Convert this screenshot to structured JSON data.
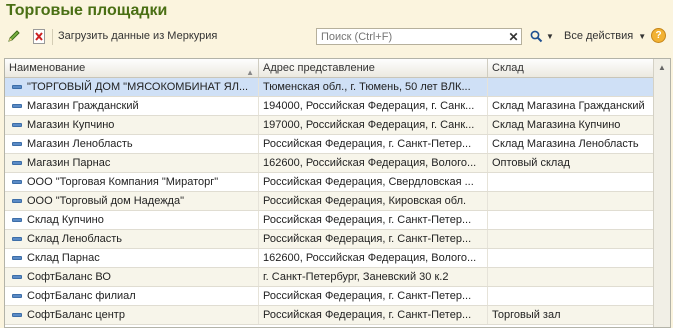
{
  "window": {
    "title": "Торговые площадки"
  },
  "toolbar": {
    "load_label": "Загрузить данные из Меркурия",
    "search_placeholder": "Поиск (Ctrl+F)",
    "search_icon": "magnifier-icon",
    "actions_label": "Все действия",
    "help_label": "?"
  },
  "colors": {
    "title": "#4a6f14",
    "selection": "#cfe0f6",
    "alt_row": "#f7f5ea"
  },
  "table": {
    "columns": [
      "Наименование",
      "Адрес представление",
      "Склад"
    ],
    "rows": [
      {
        "name": "\"ТОРГОВЫЙ ДОМ \"МЯСОКОМБИНАТ ЯЛ...",
        "address": "Тюменская обл., г. Тюмень, 50 лет ВЛК...",
        "warehouse": ""
      },
      {
        "name": "Магазин Гражданский",
        "address": "194000, Российская Федерация, г. Санк...",
        "warehouse": "Склад Магазина Гражданский"
      },
      {
        "name": "Магазин Купчино",
        "address": "197000, Российская Федерация, г. Санк...",
        "warehouse": "Склад Магазина Купчино"
      },
      {
        "name": "Магазин Ленобласть",
        "address": "Российская Федерация, г. Санкт-Петер...",
        "warehouse": "Склад Магазина Ленобласть"
      },
      {
        "name": "Магазин Парнас",
        "address": "162600, Российская Федерация, Волого...",
        "warehouse": "Оптовый склад"
      },
      {
        "name": "ООО \"Торговая Компания \"Мираторг\"",
        "address": "Российская Федерация, Свердловская ...",
        "warehouse": ""
      },
      {
        "name": "ООО \"Торговый дом Надежда\"",
        "address": "Российская Федерация, Кировская обл.",
        "warehouse": ""
      },
      {
        "name": "Склад Купчино",
        "address": "Российская Федерация, г. Санкт-Петер...",
        "warehouse": ""
      },
      {
        "name": "Склад Ленобласть",
        "address": "Российская Федерация, г. Санкт-Петер...",
        "warehouse": ""
      },
      {
        "name": "Склад Парнас",
        "address": "162600, Российская Федерация, Волого...",
        "warehouse": ""
      },
      {
        "name": "СофтБаланс ВО",
        "address": "г. Санкт-Петербург, Заневский 30 к.2",
        "warehouse": ""
      },
      {
        "name": "СофтБаланс филиал",
        "address": "Российская Федерация, г. Санкт-Петер...",
        "warehouse": ""
      },
      {
        "name": "СофтБаланс центр",
        "address": "Российская Федерация, г. Санкт-Петер...",
        "warehouse": "Торговый зал"
      }
    ]
  }
}
